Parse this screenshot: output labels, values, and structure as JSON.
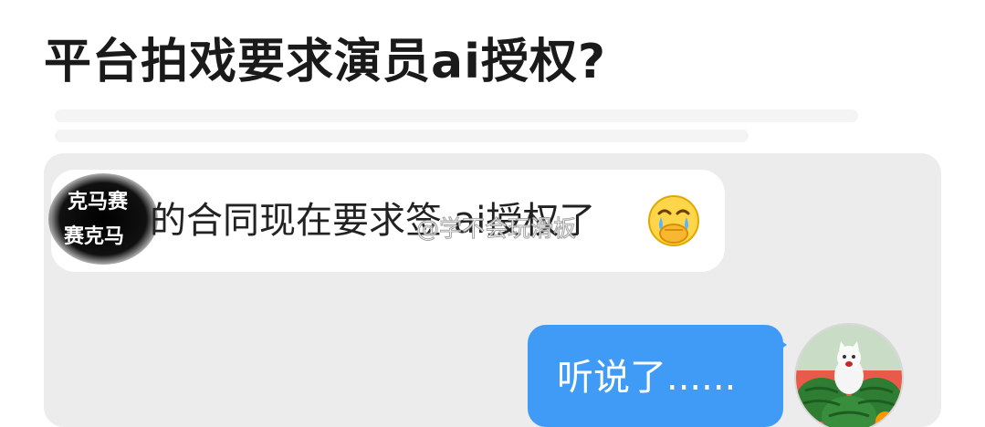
{
  "post": {
    "title": "平台拍戏要求演员ai授权?"
  },
  "chat": {
    "incoming_message": "的合同现在要求签 ai授权了",
    "incoming_emoji": "crying-covering-mouth-emoji",
    "outgoing_message": "听说了......",
    "watermark": "@学不会玩滑板",
    "redaction_text": [
      "克马赛",
      "赛克马"
    ]
  },
  "colors": {
    "chat_background": "#ececec",
    "incoming_bubble": "#ffffff",
    "outgoing_bubble": "#3f9bf5",
    "title_text": "#1a1a1a"
  },
  "icons": {
    "avatar": "cat-with-watermelons-avatar",
    "redaction": "black-brush-redaction"
  }
}
